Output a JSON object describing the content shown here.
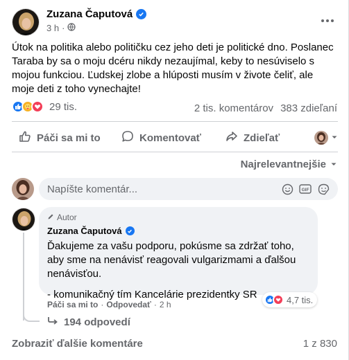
{
  "post": {
    "author": "Zuzana Čaputová",
    "time": "3 h",
    "dot": "·",
    "text": "Útok na politika alebo političku cez jeho deti je politické dno. Poslanec Taraba by sa o moju dcéru nikdy nezaujímal, keby to nesúviselo s mojou funkciou. Ľudskej zlobe a hlúposti musím v živote čeliť, ale moje deti z toho vynechajte!"
  },
  "stats": {
    "reaction_count": "29 tis.",
    "comments": "2 tis. komentárov",
    "shares": "383 zdieľaní"
  },
  "actions": {
    "like": "Páči sa mi to",
    "comment": "Komentovať",
    "share": "Zdieľať"
  },
  "sort_label": "Najrelevantnejšie",
  "composer": {
    "placeholder": "Napíšte komentár..."
  },
  "comment": {
    "badge": "Autor",
    "author": "Zuzana Čaputová",
    "text": "Ďakujeme za vašu podporu, pokúsme sa zdržať toho, aby sme na nenávisť reagovali vulgarizmami a ďalšou nenávisťou.",
    "signature": "- komunikačný tím Kancelárie prezidentky SR",
    "like": "Páči sa mi to",
    "reply": "Odpovedať",
    "time": "2 h",
    "reaction_count": "4,7 tis."
  },
  "replies_label": "194 odpovedí",
  "footer": {
    "more_comments": "Zobraziť ďalšie komentáre",
    "pager": "1 z 830"
  },
  "colors": {
    "accent": "#1877f2",
    "love": "#f33e58",
    "care": "#f7b125",
    "secondary_text": "#65676b"
  }
}
